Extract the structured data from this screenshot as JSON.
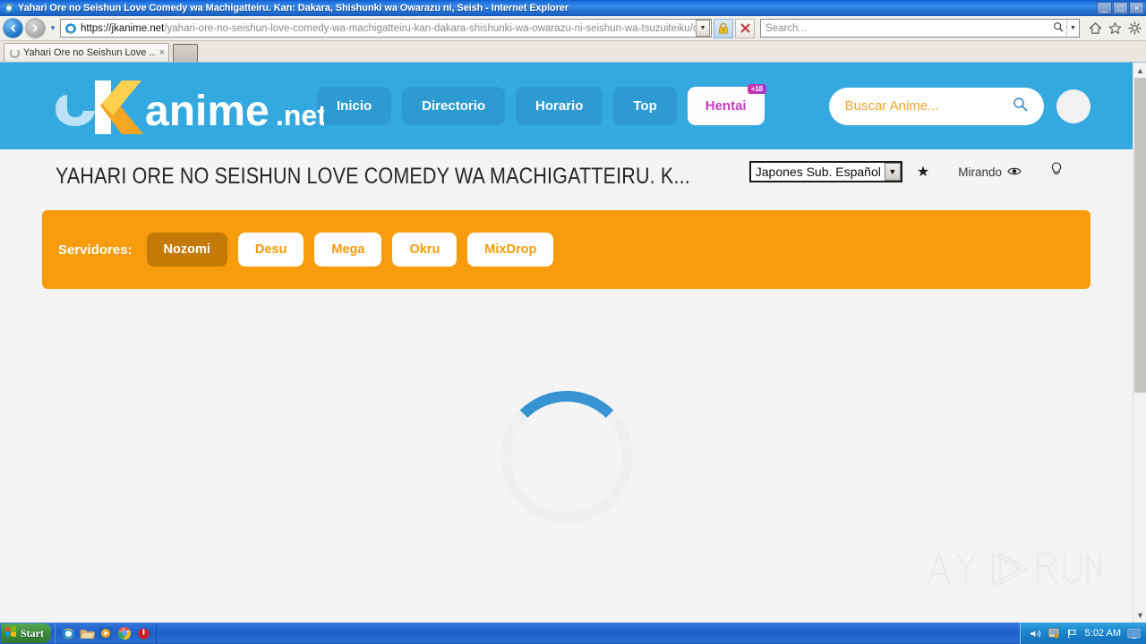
{
  "window": {
    "title": "Yahari Ore no Seishun Love Comedy wa Machigatteiru. Kan: Dakara, Shishunki wa Owarazu ni, Seish - Internet Explorer",
    "minimize_label": "_",
    "maximize_label": "□",
    "close_label": "×"
  },
  "browser": {
    "back_label": "Back",
    "forward_label": "Forward",
    "url_host": "https://jkanime.net",
    "url_path": "/yahari-ore-no-seishun-love-comedy-wa-machigatteiru-kan-dakara-shishunki-wa-owarazu-ni-seishun-wa-tsuzuiteiku/ova/",
    "url_dropdown_icon": "chevron-down-icon",
    "lock_icon": "lock-icon",
    "stop_icon": "stop-icon",
    "search_placeholder": "Search...",
    "search_icon": "search-icon",
    "search_dropdown_icon": "chevron-down-icon",
    "home_icon": "home-icon",
    "favorites_icon": "star-icon",
    "tools_icon": "gear-icon",
    "tab": {
      "title": "Yahari Ore no Seishun Love ...",
      "close_label": "×",
      "loading_icon": "spinner-icon"
    },
    "new_tab_label": ""
  },
  "site": {
    "logo_text": "JKanime.net",
    "nav": [
      {
        "label": "Inicio",
        "active": false
      },
      {
        "label": "Directorio",
        "active": false
      },
      {
        "label": "Horario",
        "active": false
      },
      {
        "label": "Top",
        "active": false
      },
      {
        "label": "Hentai",
        "active": true,
        "badge": "+18"
      }
    ],
    "search_placeholder": "Buscar Anime...",
    "search_icon": "search-icon",
    "avatar_name": "user-avatar"
  },
  "page": {
    "anime_title": "Yahari Ore no Seishun Love Comedy wa Machigatteiru. K...",
    "language_select": {
      "value": "Japones Sub. Español",
      "caret_icon": "chevron-down-icon"
    },
    "favorite_icon": "star-icon",
    "watch_status_label": "Mirando",
    "watch_status_icon": "eye-icon",
    "lights_icon": "lightbulb-icon",
    "servers_label": "Servidores:",
    "servers": [
      {
        "label": "Nozomi",
        "active": true
      },
      {
        "label": "Desu",
        "active": false
      },
      {
        "label": "Mega",
        "active": false
      },
      {
        "label": "Okru",
        "active": false
      },
      {
        "label": "MixDrop",
        "active": false
      }
    ],
    "loading_icon": "loading-spinner",
    "watermark_text": "ANY RUN"
  },
  "colors": {
    "site_header_blue": "#34a9e0",
    "nav_button_blue": "#2d9ad2",
    "servers_orange": "#f79c0c",
    "server_active_orange": "#c47a06",
    "hentai_pink": "#c13ec1",
    "spinner_blue": "#3793d2",
    "search_placeholder_gold": "#f0a32a",
    "page_background": "#f4f4f4"
  },
  "taskbar": {
    "start_label": "Start",
    "quicklaunch": [
      {
        "name": "internet-explorer-icon"
      },
      {
        "name": "folder-icon"
      },
      {
        "name": "media-player-icon"
      },
      {
        "name": "chrome-icon"
      },
      {
        "name": "power-icon"
      }
    ],
    "tray": {
      "volume_icon": "volume-icon",
      "shield_icon": "security-shield-icon",
      "network_icon": "network-flag-icon",
      "clock": "5:02 AM",
      "desktop_icon": "show-desktop-icon"
    }
  }
}
